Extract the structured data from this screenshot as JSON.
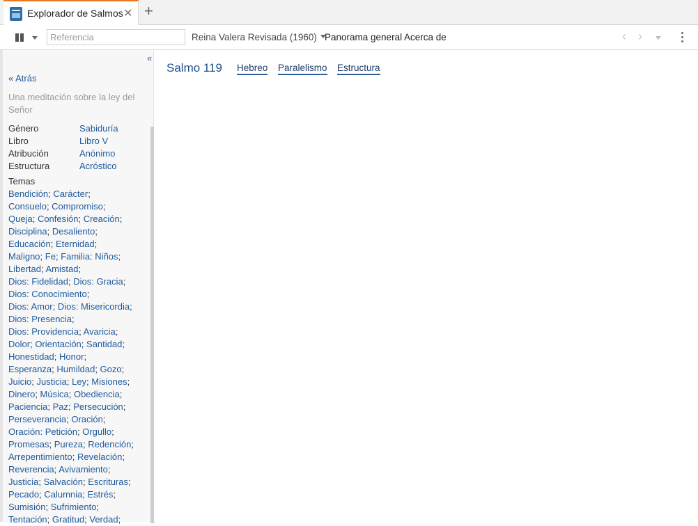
{
  "tab": {
    "title": "Explorador de Salmos",
    "close_glyph": "✕",
    "add_glyph": "+",
    "icon": "psalms-explorer-icon"
  },
  "toolbar": {
    "reference_placeholder": "Referencia",
    "version_label": "Reina Valera Revisada (1960)",
    "overview_label": "Panorama general",
    "about_label": "Acerca de",
    "back_arrow": "‹",
    "forward_arrow": "›"
  },
  "sidebar": {
    "collapse_glyph": "«",
    "back_label": "« Atrás",
    "description": "Una meditación sobre la ley del Señor",
    "properties": [
      {
        "label": "Género",
        "value": "Sabiduría"
      },
      {
        "label": "Libro",
        "value": "Libro V"
      },
      {
        "label": "Atribución",
        "value": "Anónimo"
      },
      {
        "label": "Estructura",
        "value": "Acróstico"
      }
    ],
    "themes_label": "Temas",
    "theme_lines": [
      [
        "Bendición",
        "Carácter"
      ],
      [
        "Consuelo",
        "Compromiso"
      ],
      [
        "Queja",
        "Confesión",
        "Creación"
      ],
      [
        "Disciplina",
        "Desaliento"
      ],
      [
        "Educación",
        "Eternidad"
      ],
      [
        "Maligno",
        "Fe",
        "Familia: Niños"
      ],
      [
        "Libertad",
        "Amistad"
      ],
      [
        "Dios: Fidelidad",
        "Dios: Gracia"
      ],
      [
        "Dios: Conocimiento"
      ],
      [
        "Dios: Amor",
        "Dios: Misericordia"
      ],
      [
        "Dios: Presencia"
      ],
      [
        "Dios: Providencia",
        "Avaricia"
      ],
      [
        "Dolor",
        "Orientación",
        "Santidad"
      ],
      [
        "Honestidad",
        "Honor"
      ],
      [
        "Esperanza",
        "Humildad",
        "Gozo"
      ],
      [
        "Juicio",
        "Justicia",
        "Ley",
        "Misiones"
      ],
      [
        "Dinero",
        "Música",
        "Obediencia"
      ],
      [
        "Paciencia",
        "Paz",
        "Persecución"
      ],
      [
        "Perseverancia",
        "Oración"
      ],
      [
        "Oración: Petición",
        "Orgullo"
      ],
      [
        "Promesas",
        "Pureza",
        "Redención"
      ],
      [
        "Arrepentimiento",
        "Revelación"
      ],
      [
        "Reverencia",
        "Avivamiento"
      ],
      [
        "Justicia",
        "Salvación",
        "Escrituras"
      ],
      [
        "Pecado",
        "Calumnia",
        "Estrés"
      ],
      [
        "Sumisión",
        "Sufrimiento"
      ],
      [
        "Tentación",
        "Gratitud",
        "Verdad"
      ]
    ]
  },
  "main": {
    "psalm_title": "Salmo 119",
    "views": [
      "Hebreo",
      "Paralelismo",
      "Estructura"
    ]
  }
}
